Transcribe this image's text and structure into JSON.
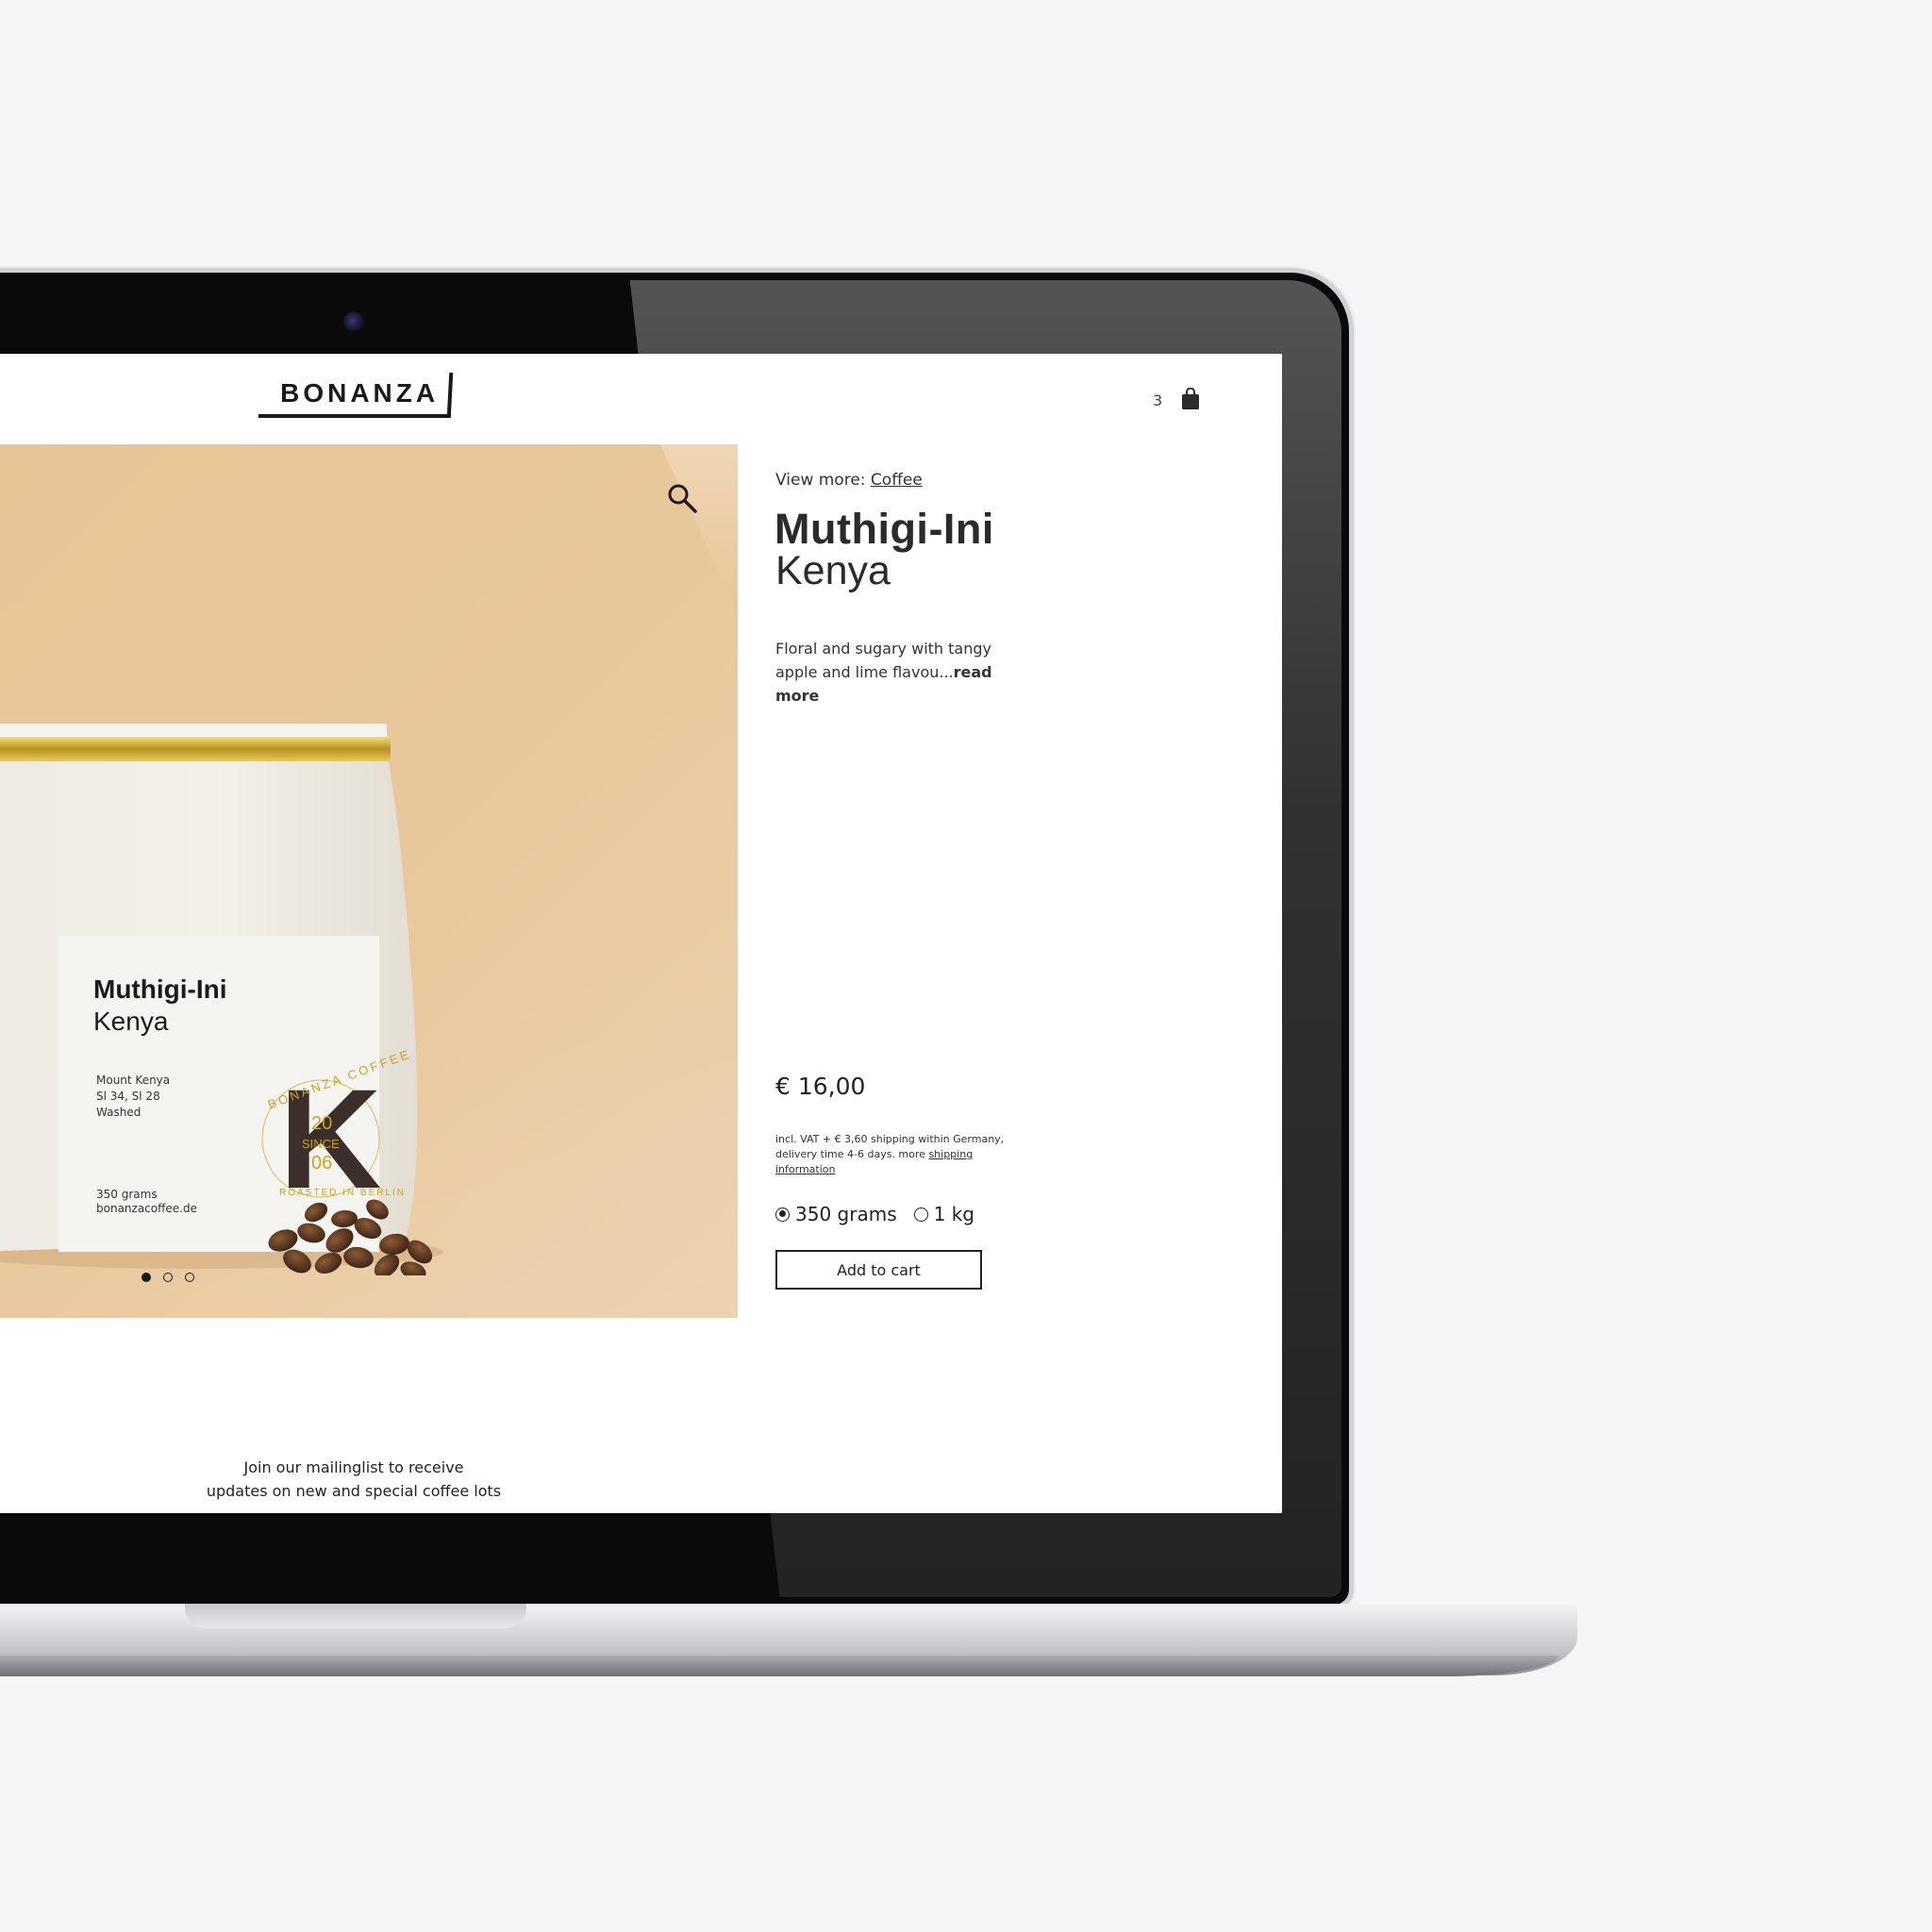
{
  "header": {
    "logo": "BONANZA",
    "cart_count": "3",
    "cart_icon": "shopping-bag-icon"
  },
  "hero": {
    "zoom_icon": "magnifier-icon",
    "label": {
      "title": "Muthigi-Ini",
      "subtitle": "Kenya",
      "meta": "Mount Kenya\nSl 34, Sl 28\nWashed",
      "footer": "350 grams\nbonanzacoffee.de",
      "stamp_letter": "K",
      "stamp_text_top": "BONANZA COFFEE",
      "stamp_year_a": "20",
      "stamp_since": "SINCE",
      "stamp_year_b": "06",
      "stamp_text_bottom": "ROASTED IN BERLIN"
    },
    "carousel": {
      "count": 3,
      "active": 0
    }
  },
  "product": {
    "view_more_prefix": "View more: ",
    "view_more_link": "Coffee",
    "title": "Muthigi-Ini",
    "subtitle": "Kenya",
    "description": "Floral and sugary with tangy apple and lime flavou...",
    "read_more": "read more",
    "price": "€ 16,00",
    "vat_text": "incl. VAT + € 3,60 shipping within Germany, delivery time 4-6 days. more ",
    "vat_link": "shipping information",
    "options": [
      {
        "label": "350 grams",
        "selected": true
      },
      {
        "label": "1 kg",
        "selected": false
      }
    ],
    "add_to_cart": "Add to cart"
  },
  "footer": {
    "mailing_line1": "Join our mailinglist to receive",
    "mailing_line2": "updates on new and special coffee lots"
  },
  "colors": {
    "hero_bg": "#e8c69a",
    "text": "#2b2b2b",
    "accent_gold": "#c9a227"
  }
}
